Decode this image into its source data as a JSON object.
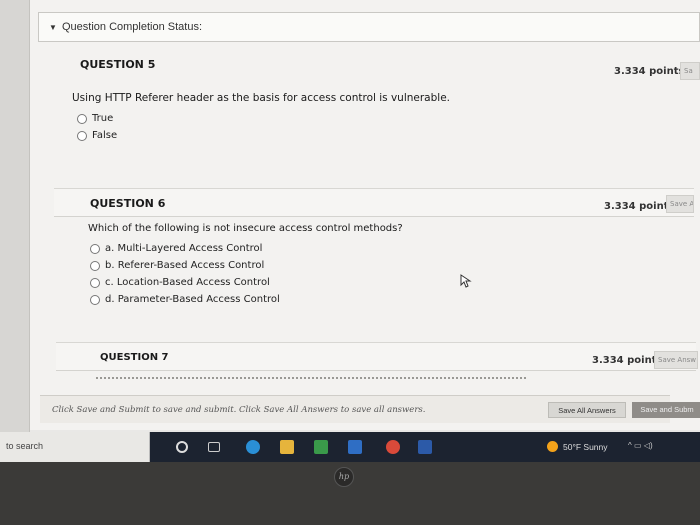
{
  "status": {
    "label": "Question Completion Status:"
  },
  "questions": [
    {
      "title": "QUESTION 5",
      "points": "3.334 points",
      "save_label": "Sa",
      "text": "Using HTTP Referer header as the basis for access control is vulnerable.",
      "options": [
        "True",
        "False"
      ]
    },
    {
      "title": "QUESTION 6",
      "points": "3.334 points",
      "save_label": "Save A",
      "text": "Which of the following is not insecure access control methods?",
      "options": [
        "a. Multi-Layered Access Control",
        "b. Referer-Based Access Control",
        "c. Location-Based Access Control",
        "d. Parameter-Based Access Control"
      ]
    },
    {
      "title": "QUESTION 7",
      "points": "3.334 points",
      "save_label": "Save Answ"
    }
  ],
  "footer": {
    "instruction": "Click Save and Submit to save and submit. Click Save All Answers to save all answers.",
    "save_all_label": "Save All Answers",
    "submit_label": "Save and Subm"
  },
  "taskbar": {
    "search_text": "to search",
    "weather": "50°F Sunny",
    "app_icons": [
      "cortana-icon",
      "task-view-icon",
      "edge-icon",
      "file-explorer-icon",
      "store-icon",
      "mail-icon",
      "chrome-icon",
      "word-icon"
    ]
  },
  "colors": {
    "taskbar": "#1c2330",
    "sun": "#f3a21a"
  }
}
